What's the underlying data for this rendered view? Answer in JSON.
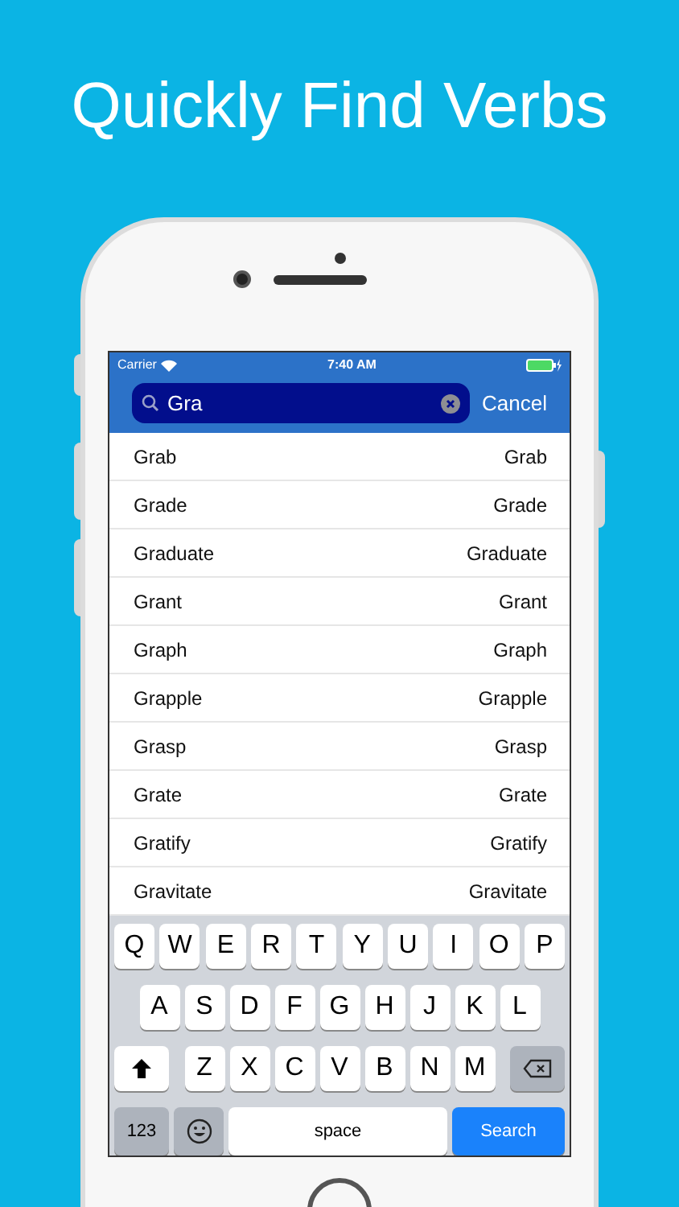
{
  "headline": "Quickly Find Verbs",
  "status_bar": {
    "carrier": "Carrier",
    "time": "7:40 AM"
  },
  "search": {
    "value": "Gra",
    "cancel": "Cancel"
  },
  "results": [
    {
      "word": "Grab",
      "translation": "Grab"
    },
    {
      "word": "Grade",
      "translation": "Grade"
    },
    {
      "word": "Graduate",
      "translation": "Graduate"
    },
    {
      "word": "Grant",
      "translation": "Grant"
    },
    {
      "word": "Graph",
      "translation": "Graph"
    },
    {
      "word": "Grapple",
      "translation": "Grapple"
    },
    {
      "word": "Grasp",
      "translation": "Grasp"
    },
    {
      "word": "Grate",
      "translation": "Grate"
    },
    {
      "word": "Gratify",
      "translation": "Gratify"
    },
    {
      "word": "Gravitate",
      "translation": "Gravitate"
    }
  ],
  "keyboard": {
    "rows": [
      [
        "Q",
        "W",
        "E",
        "R",
        "T",
        "Y",
        "U",
        "I",
        "O",
        "P"
      ],
      [
        "A",
        "S",
        "D",
        "F",
        "G",
        "H",
        "J",
        "K",
        "L"
      ],
      [
        "Z",
        "X",
        "C",
        "V",
        "B",
        "N",
        "M"
      ]
    ],
    "numbers": "123",
    "space": "space",
    "return": "Search"
  }
}
